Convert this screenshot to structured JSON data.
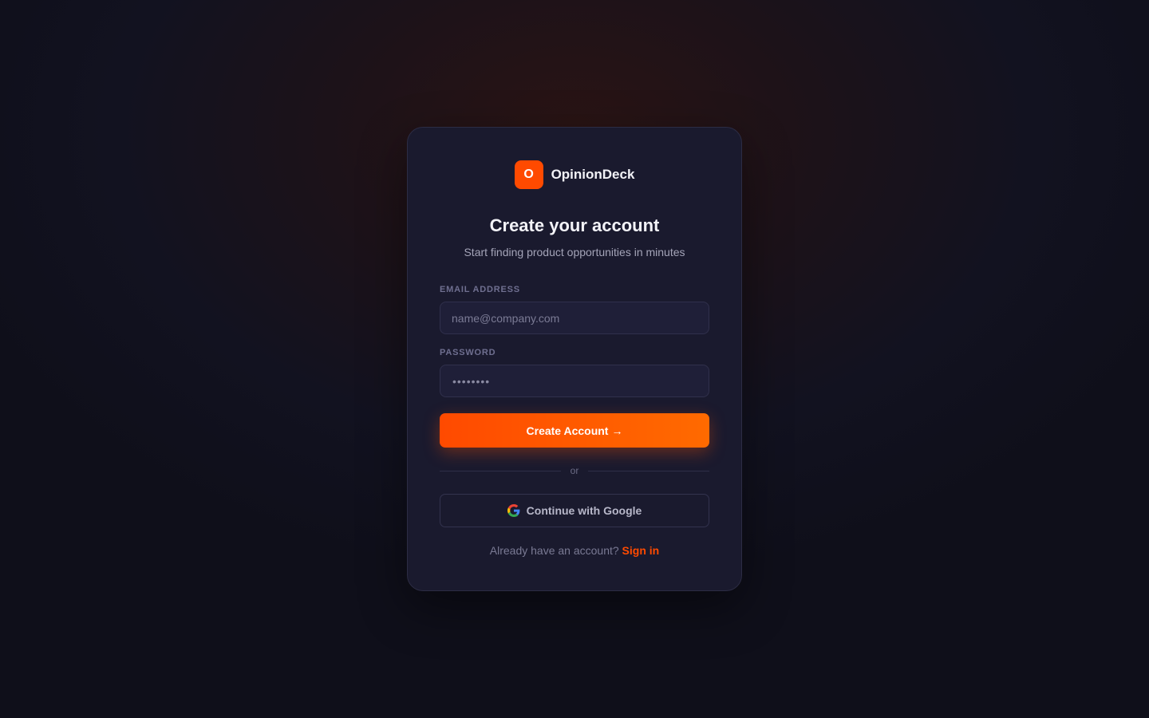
{
  "brand": {
    "logo_letter": "O",
    "name": "OpinionDeck",
    "accent": "#ff4a00"
  },
  "header": {
    "title": "Create your account",
    "subtitle": "Start finding product opportunities in minutes"
  },
  "form": {
    "email_label": "EMAIL ADDRESS",
    "email_placeholder": "name@company.com",
    "email_value": "",
    "password_label": "PASSWORD",
    "password_value": "••••••••",
    "submit_label": "Create Account",
    "submit_arrow": "→"
  },
  "divider": {
    "label": "or"
  },
  "google": {
    "label": "Continue with Google",
    "icon": "google-icon"
  },
  "footer": {
    "prompt": "Already have an account?",
    "link_label": "Sign in"
  }
}
